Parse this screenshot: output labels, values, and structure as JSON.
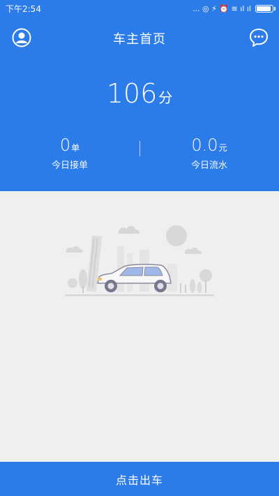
{
  "status_bar": {
    "time": "下午2:54",
    "indicators": "... ◎ ⚡ ⏰ ≋ ıl ıl",
    "battery_level": 0.95
  },
  "header": {
    "title": "车主首页",
    "profile_icon": "profile-icon",
    "message_icon": "chat-bubble-icon",
    "score": {
      "value": "106",
      "unit": "分"
    },
    "stats": [
      {
        "value": "0",
        "unit": "单",
        "label": "今日接单"
      },
      {
        "value": "0.0",
        "unit": "元",
        "label": "今日流水"
      }
    ]
  },
  "colors": {
    "primary": "#2b7be9",
    "background": "#efefef"
  },
  "action": {
    "label": "点击出车"
  }
}
